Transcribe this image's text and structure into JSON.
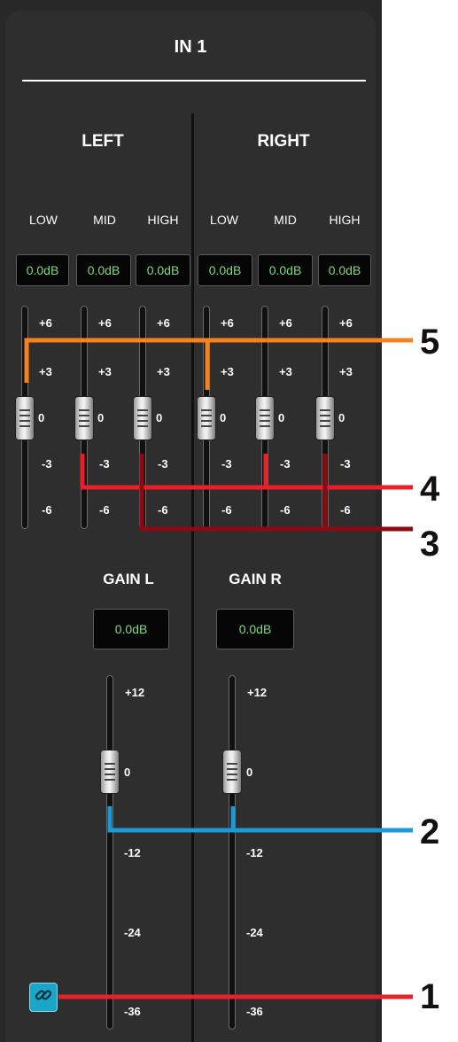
{
  "panel": {
    "title": "IN 1",
    "sections": {
      "left": "LEFT",
      "right": "RIGHT"
    }
  },
  "eq": {
    "left": [
      {
        "band": "LOW",
        "value": "0.0dB",
        "level_db": 0
      },
      {
        "band": "MID",
        "value": "0.0dB",
        "level_db": 0
      },
      {
        "band": "HIGH",
        "value": "0.0dB",
        "level_db": 0
      }
    ],
    "right": [
      {
        "band": "LOW",
        "value": "0.0dB",
        "level_db": 0
      },
      {
        "band": "MID",
        "value": "0.0dB",
        "level_db": 0
      },
      {
        "band": "HIGH",
        "value": "0.0dB",
        "level_db": 0
      }
    ],
    "scale": [
      "+6",
      "+3",
      "0",
      "-3",
      "-6"
    ]
  },
  "gain": {
    "left": {
      "label": "GAIN L",
      "value": "0.0dB",
      "level_db": 0
    },
    "right": {
      "label": "GAIN R",
      "value": "0.0dB",
      "level_db": 0
    },
    "scale": [
      "+12",
      "0",
      "-12",
      "-24",
      "-36"
    ]
  },
  "link_button": {
    "icon": "link-icon"
  },
  "callouts": [
    {
      "number": "5",
      "color": "#f5821f"
    },
    {
      "number": "4",
      "color": "#e8202a"
    },
    {
      "number": "3",
      "color": "#8b0a14"
    },
    {
      "number": "2",
      "color": "#1b9ad6"
    },
    {
      "number": "1",
      "color": "#e8202a"
    }
  ]
}
